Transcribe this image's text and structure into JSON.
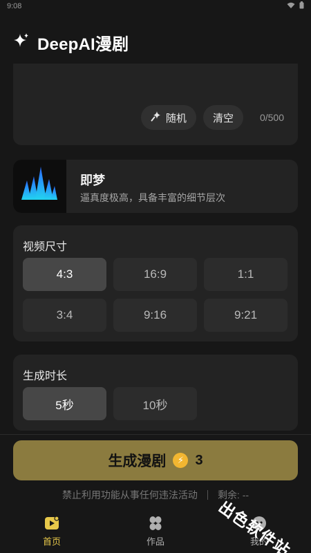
{
  "status_bar": {
    "time": "9:08"
  },
  "header": {
    "title": "DeepAI漫剧"
  },
  "prompt": {
    "random_label": "随机",
    "clear_label": "清空",
    "counter": "0/500"
  },
  "model": {
    "name": "即梦",
    "description": "逼真度极高，具备丰富的细节层次"
  },
  "video_size": {
    "title": "视频尺寸",
    "options": [
      "4:3",
      "16:9",
      "1:1",
      "3:4",
      "9:16",
      "9:21"
    ],
    "selected": "4:3"
  },
  "duration": {
    "title": "生成时长",
    "options": [
      "5秒",
      "10秒"
    ],
    "selected": "5秒"
  },
  "generate": {
    "label": "生成漫剧",
    "cost": "3"
  },
  "footnote": {
    "warning": "禁止利用功能从事任何违法活动",
    "remaining": "剩余: --"
  },
  "tabs": [
    {
      "label": "首页",
      "icon": "play-icon",
      "active": true
    },
    {
      "label": "作品",
      "icon": "grid-icon",
      "active": false
    },
    {
      "label": "我的",
      "icon": "profile-icon",
      "active": false
    }
  ],
  "watermark": "出色软件站",
  "colors": {
    "background": "#171717",
    "card": "#232323",
    "accent_button": "#8b7b3f",
    "active_tab": "#e7c84a",
    "coin": "#f2b631"
  }
}
